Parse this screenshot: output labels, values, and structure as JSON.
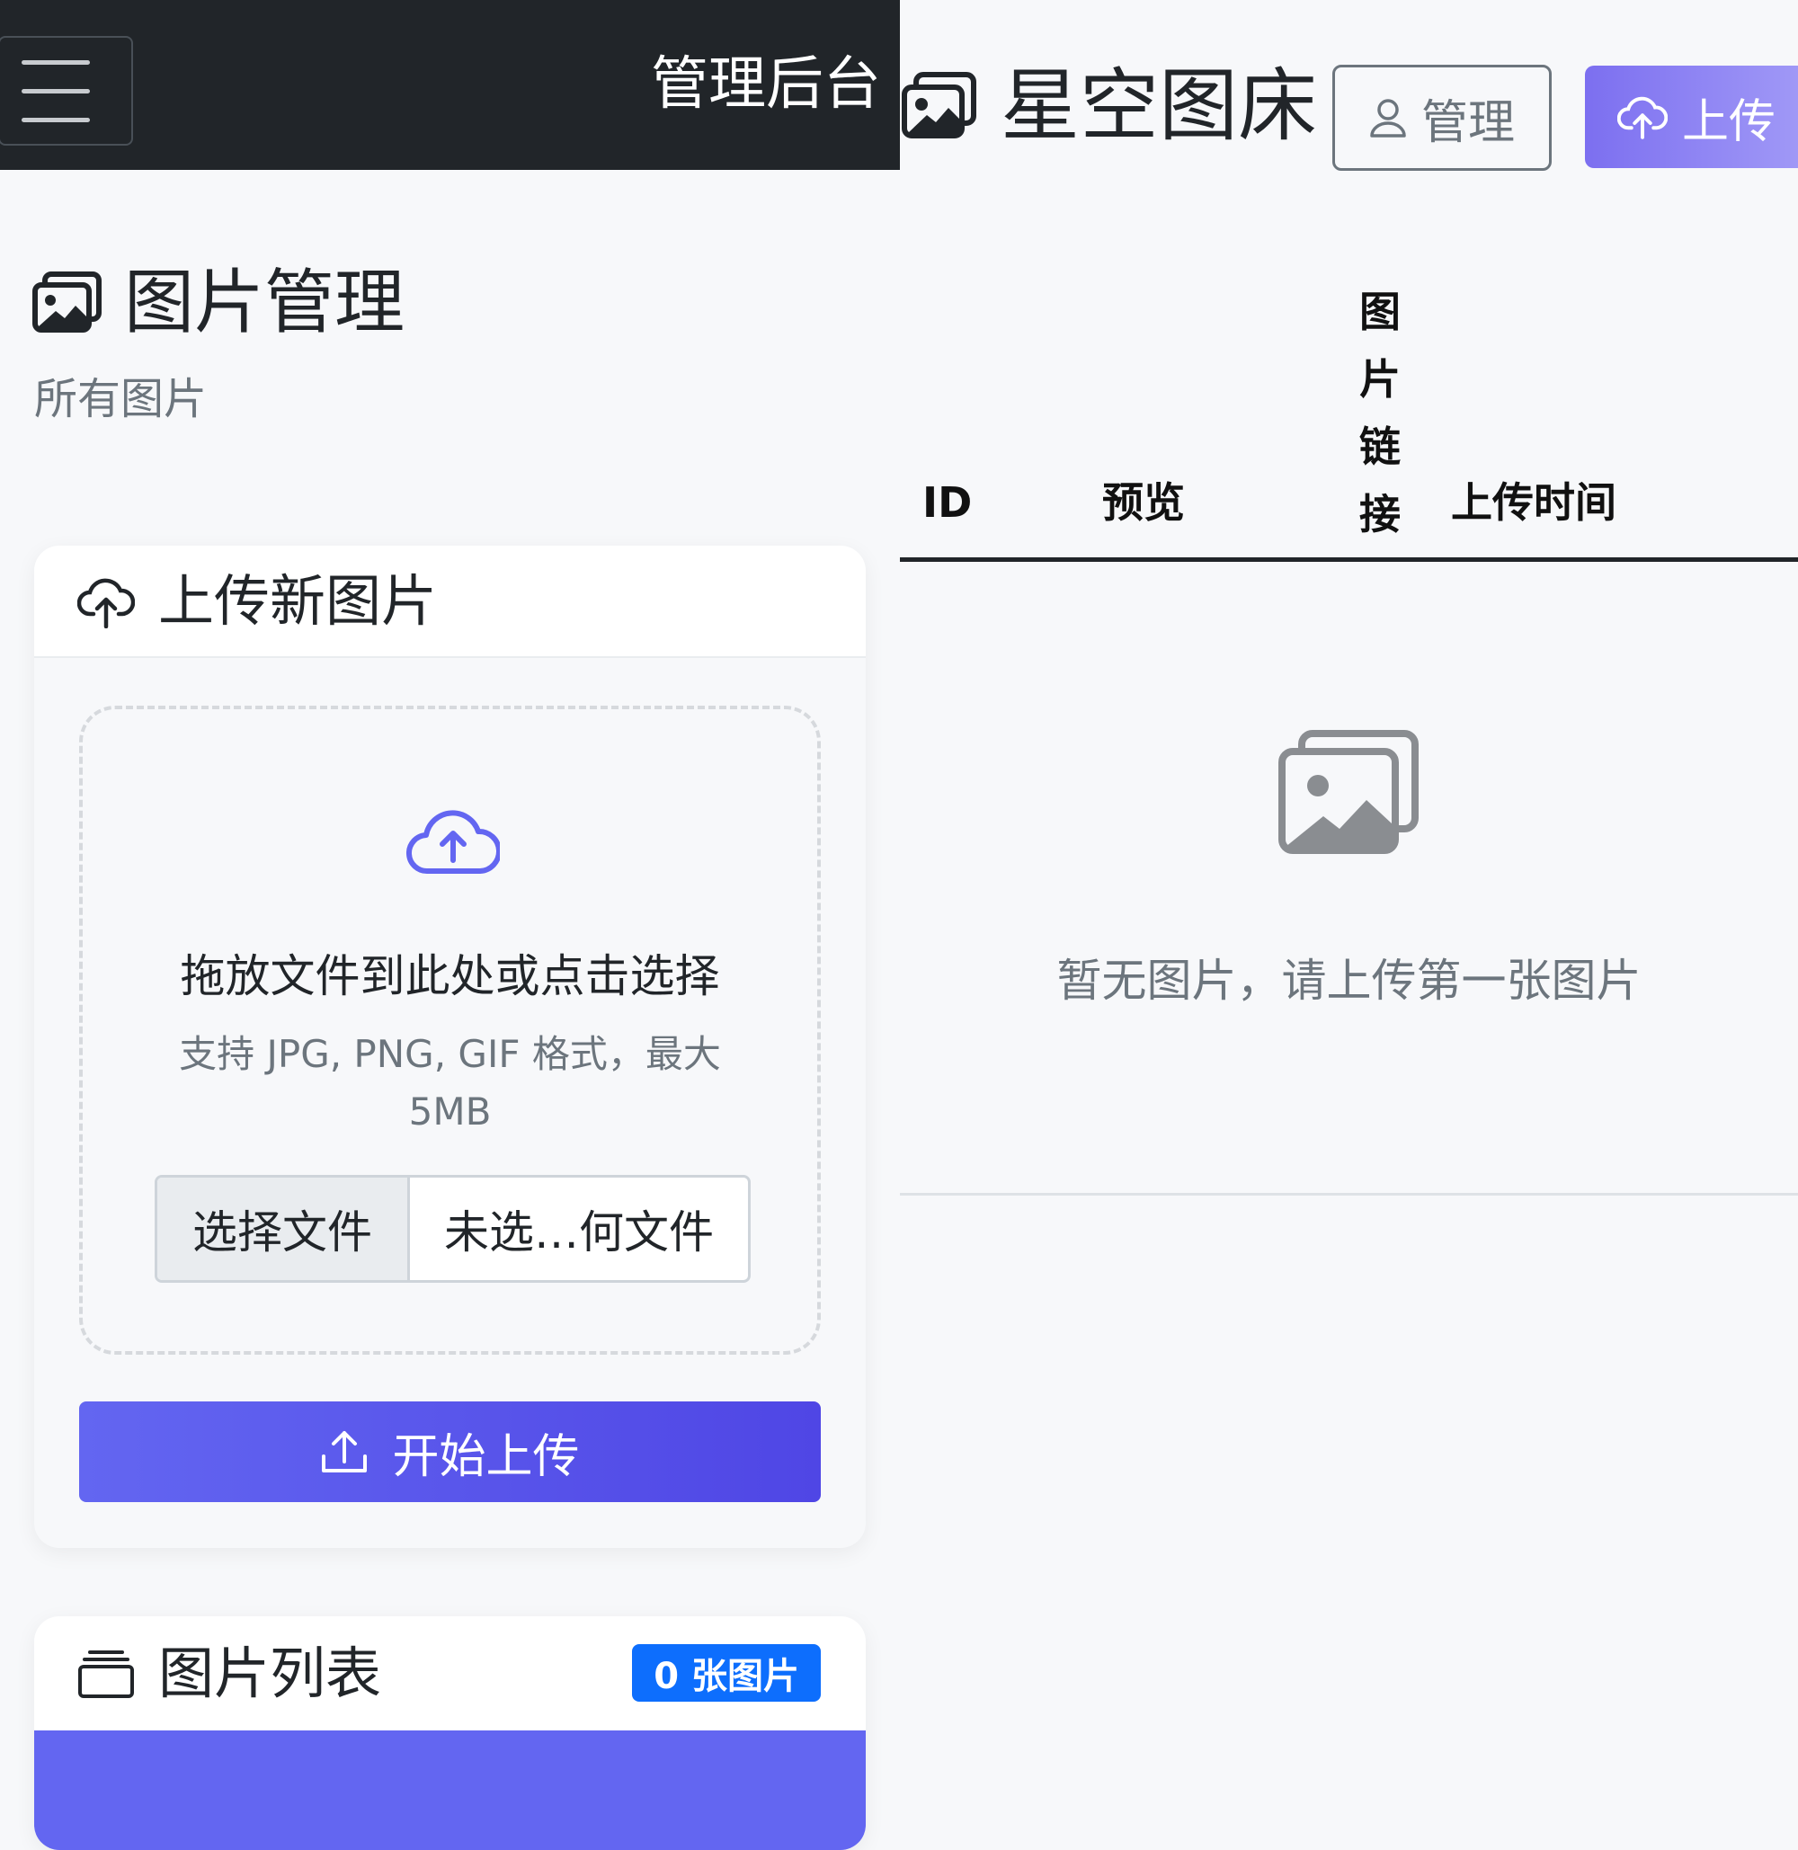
{
  "admin_navbar": {
    "title": "管理后台",
    "menu_icon": "hamburger-menu-icon"
  },
  "page": {
    "heading": "图片管理",
    "heading_icon": "images-icon",
    "subtitle": "所有图片"
  },
  "upload_card": {
    "title": "上传新图片",
    "title_icon": "cloud-upload-icon",
    "dropzone": {
      "icon": "cloud-arrow-up-icon",
      "main_text": "拖放文件到此处或点击选择",
      "hint_text": "支持 JPG, PNG, GIF 格式，最大 5MB"
    },
    "file_input": {
      "button_label": "选择文件",
      "status": "未选…何文件"
    },
    "start_button": {
      "label": "开始上传",
      "icon": "upload-icon"
    }
  },
  "list_card": {
    "title": "图片列表",
    "title_icon": "collection-icon",
    "count_badge": "0 张图片"
  },
  "site": {
    "brand": "星空图床",
    "brand_icon": "images-icon",
    "admin_button": "管理",
    "admin_icon": "person-icon",
    "upload_button": "上传",
    "upload_icon": "cloud-upload-icon"
  },
  "table": {
    "columns": [
      "ID",
      "预览",
      "图片链接",
      "上传时间"
    ],
    "empty_icon": "images-icon",
    "empty_text": "暂无图片，请上传第一张图片"
  },
  "colors": {
    "accent": "#6366f1",
    "badge": "#0d6efd",
    "navbar": "#212529"
  }
}
